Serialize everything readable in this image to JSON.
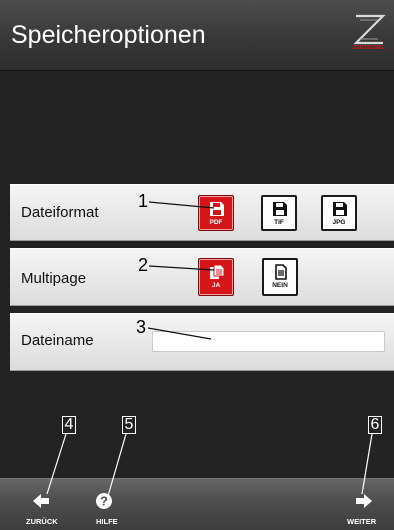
{
  "header": {
    "title": "Speicheroptionen",
    "logo_text": "ZEUTSCHEL"
  },
  "rows": {
    "format": {
      "label": "Dateiformat",
      "callout": "1",
      "options": [
        {
          "label": "PDF",
          "selected": true,
          "icon": "floppy-disk-icon"
        },
        {
          "label": "TIF",
          "selected": false,
          "icon": "floppy-disk-icon"
        },
        {
          "label": "JPG",
          "selected": false,
          "icon": "floppy-disk-icon"
        }
      ]
    },
    "multipage": {
      "label": "Multipage",
      "callout": "2",
      "options": [
        {
          "label": "JA",
          "selected": true,
          "icon": "multi-page-document-icon"
        },
        {
          "label": "NEIN",
          "selected": false,
          "icon": "single-page-document-icon"
        }
      ]
    },
    "filename": {
      "label": "Dateiname",
      "callout": "3",
      "value": ""
    }
  },
  "footer": {
    "back": {
      "label": "ZURÜCK",
      "callout": "4",
      "icon": "arrow-left-icon"
    },
    "help": {
      "label": "HILFE",
      "callout": "5",
      "icon": "help-icon"
    },
    "next": {
      "label": "WEITER",
      "callout": "6",
      "icon": "arrow-right-icon"
    }
  },
  "colors": {
    "accent": "#d4161b",
    "background": "#232323",
    "header": "#3a3a3a",
    "row": "#e8e8e8"
  }
}
